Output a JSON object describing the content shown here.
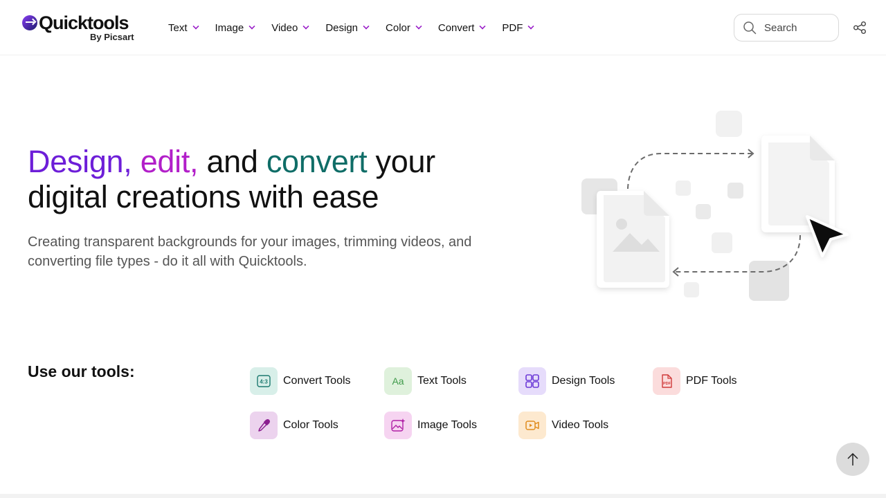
{
  "brand": {
    "name": "Quicktools",
    "sub": "By Picsart"
  },
  "nav": [
    {
      "label": "Text"
    },
    {
      "label": "Image"
    },
    {
      "label": "Video"
    },
    {
      "label": "Design"
    },
    {
      "label": "Color"
    },
    {
      "label": "Convert"
    },
    {
      "label": "PDF"
    }
  ],
  "search": {
    "placeholder": "Search"
  },
  "hero": {
    "w1": "Design,",
    "w2": "edit,",
    "w3": "and",
    "w4": "convert",
    "w5": "your",
    "line2": "digital creations with ease",
    "subtitle": "Creating transparent backgrounds for your images, trimming videos, and converting file types - do it all with Quicktools."
  },
  "tools": {
    "heading": "Use our tools:",
    "items": [
      {
        "label": "Convert Tools",
        "icon_text": "4:3",
        "icon": "aspect-ratio-icon",
        "bg": "#d8efe9",
        "fg": "#1c7a70"
      },
      {
        "label": "Text Tools",
        "icon_text": "Aa",
        "icon": "text-aa-icon",
        "bg": "#dff1dc",
        "fg": "#3f9a4a"
      },
      {
        "label": "Design Tools",
        "icon": "grid-layout-icon",
        "bg": "#e6dcfb",
        "fg": "#6d3bd8"
      },
      {
        "label": "PDF Tools",
        "icon_text": "PDF",
        "icon": "pdf-file-icon",
        "bg": "#fbdcdc",
        "fg": "#d03a3a"
      },
      {
        "label": "Color Tools",
        "icon": "eyedropper-icon",
        "bg": "#ecd3ee",
        "fg": "#8a1f8f"
      },
      {
        "label": "Image Tools",
        "icon": "image-sparkle-icon",
        "bg": "#f6d4f1",
        "fg": "#b01fa6"
      },
      {
        "label": "Video Tools",
        "icon": "video-play-icon",
        "bg": "#fde9cf",
        "fg": "#e08c1d"
      }
    ]
  },
  "colors": {
    "purple": "#6d1ed8",
    "magenta": "#b21fc9",
    "teal": "#0f6d67",
    "nav_chevron": "#9a1fc8"
  }
}
